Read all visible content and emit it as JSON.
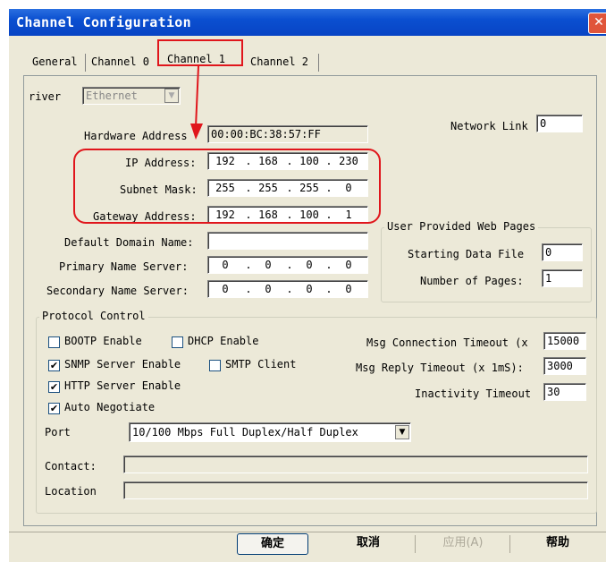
{
  "window": {
    "title": "Channel Configuration",
    "close_glyph": "✕"
  },
  "tabs": [
    {
      "label": "General"
    },
    {
      "label": "Channel 0"
    },
    {
      "label": "Channel 1"
    },
    {
      "label": "Channel 2"
    }
  ],
  "driver": {
    "label": "river",
    "value": "Ethernet"
  },
  "network_link": {
    "label": "Network Link",
    "value": "0"
  },
  "hardware_address": {
    "label": "Hardware Address",
    "value": "00:00:BC:38:57:FF"
  },
  "ip_address": {
    "label": "IP Address:",
    "octets": [
      "192",
      "168",
      "100",
      "230"
    ]
  },
  "subnet_mask": {
    "label": "Subnet Mask:",
    "octets": [
      "255",
      "255",
      "255",
      "0"
    ]
  },
  "gateway": {
    "label": "Gateway Address:",
    "octets": [
      "192",
      "168",
      "100",
      "1"
    ]
  },
  "default_domain": {
    "label": "Default Domain Name:",
    "value": ""
  },
  "primary_ns": {
    "label": "Primary Name Server:",
    "octets": [
      "0",
      "0",
      "0",
      "0"
    ]
  },
  "secondary_ns": {
    "label": "Secondary Name Server:",
    "octets": [
      "0",
      "0",
      "0",
      "0"
    ]
  },
  "ip_dot": ".",
  "web_pages": {
    "title": "User Provided Web Pages",
    "starting_label": "Starting Data File",
    "starting_value": "0",
    "pages_label": "Number of Pages:",
    "pages_value": "1"
  },
  "protocol": {
    "title": "Protocol Control",
    "bootp_label": "BOOTP Enable",
    "dhcp_label": "DHCP Enable",
    "snmp_label": "SNMP Server Enable",
    "smtp_label": "SMTP Client",
    "http_label": "HTTP Server Enable",
    "autoneg_label": "Auto Negotiate",
    "check_glyph": "✔",
    "bootp_checked": false,
    "dhcp_checked": false,
    "snmp_checked": true,
    "smtp_checked": false,
    "http_checked": true,
    "autoneg_checked": true,
    "msg_conn_label": "Msg Connection Timeout (x",
    "msg_conn_value": "15000",
    "msg_reply_label": "Msg Reply Timeout (x 1mS):",
    "msg_reply_value": "3000",
    "inactivity_label": "Inactivity Timeout",
    "inactivity_value": "30",
    "port_label": "Port",
    "port_value": "10/100 Mbps Full Duplex/Half Duplex",
    "contact_label": "Contact:",
    "contact_value": "",
    "location_label": "Location",
    "location_value": ""
  },
  "buttons": {
    "ok": "确定",
    "cancel": "取消",
    "apply": "应用(A)",
    "help": "帮助"
  },
  "dropdown_glyph": "▼",
  "annotation": {
    "color": "#e0161c"
  }
}
